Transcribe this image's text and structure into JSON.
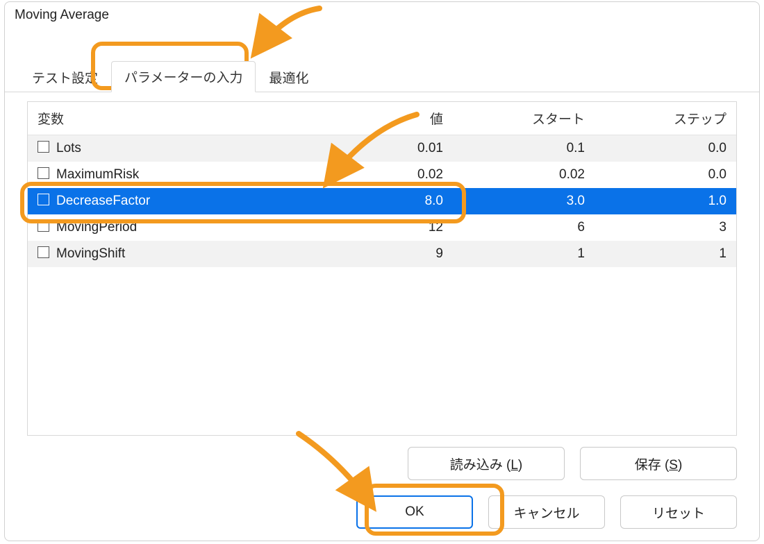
{
  "window": {
    "title": "Moving Average"
  },
  "tabs": [
    {
      "label": "テスト設定",
      "active": false
    },
    {
      "label": "パラメーターの入力",
      "active": true
    },
    {
      "label": "最適化",
      "active": false
    }
  ],
  "columns": {
    "variable": "変数",
    "value": "値",
    "start": "スタート",
    "step": "ステップ"
  },
  "rows": [
    {
      "checked": false,
      "name": "Lots",
      "value": "0.01",
      "start": "0.1",
      "step": "0.0",
      "sel": false,
      "alt": true
    },
    {
      "checked": false,
      "name": "MaximumRisk",
      "value": "0.02",
      "start": "0.02",
      "step": "0.0",
      "sel": false,
      "alt": false
    },
    {
      "checked": false,
      "name": "DecreaseFactor",
      "value": "8.0",
      "start": "3.0",
      "step": "1.0",
      "sel": true,
      "alt": false
    },
    {
      "checked": false,
      "name": "MovingPeriod",
      "value": "12",
      "start": "6",
      "step": "3",
      "sel": false,
      "alt": false
    },
    {
      "checked": false,
      "name": "MovingShift",
      "value": "9",
      "start": "1",
      "step": "1",
      "sel": false,
      "alt": true
    }
  ],
  "buttons": {
    "load": "読み込み (L)",
    "save": "保存 (S)",
    "ok": "OK",
    "cancel": "キャンセル",
    "reset": "リセット"
  }
}
